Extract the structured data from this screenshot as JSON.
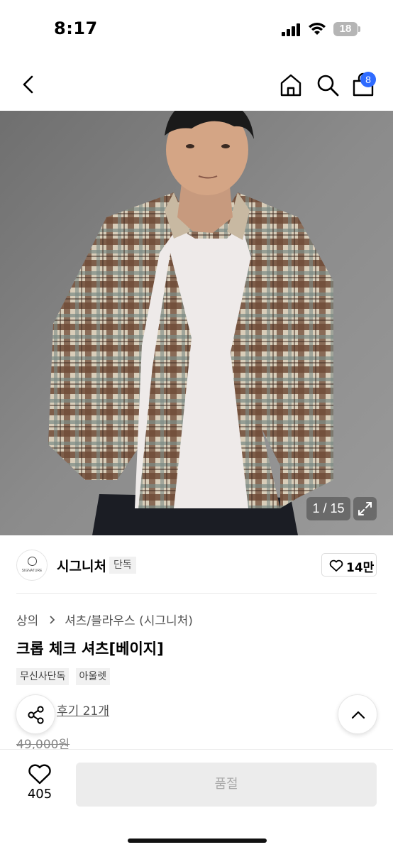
{
  "status_bar": {
    "time": "8:17",
    "battery_level": "18",
    "icons": [
      "signal-icon",
      "wifi-icon",
      "battery-icon"
    ]
  },
  "nav": {
    "cart_badge": "8",
    "icons": [
      "back-icon",
      "home-icon",
      "search-icon",
      "cart-icon"
    ]
  },
  "gallery": {
    "counter": "1 / 15",
    "icons": [
      "expand-icon"
    ]
  },
  "brand": {
    "name": "시그니처",
    "logo_text": "SIGNATURE",
    "tag": "단독",
    "like_count": "14만"
  },
  "product": {
    "breadcrumb": [
      "상의",
      "셔츠/블라우스 (시그니처)"
    ],
    "title": "크롭 체크 셔츠[베이지]",
    "tags": [
      "무신사단독",
      "아울렛"
    ],
    "review_link": "후기 21개",
    "original_price": "49,000원"
  },
  "bottom_bar": {
    "wish_count": "405",
    "soldout_label": "품절"
  },
  "colors": {
    "badge": "#2f6bff",
    "disabled_button": "#ececec",
    "disabled_text": "#aaaaaa"
  }
}
